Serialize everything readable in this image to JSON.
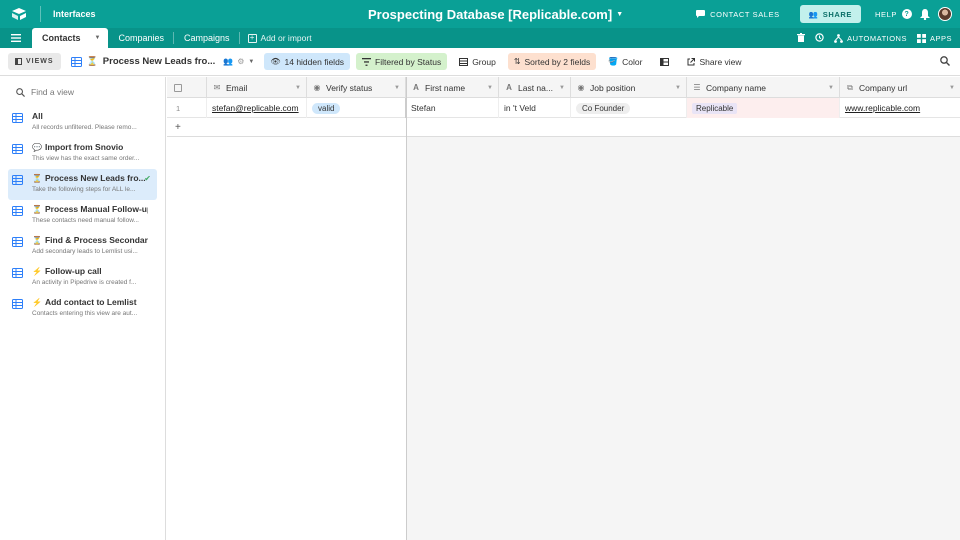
{
  "topbar": {
    "section": "Interfaces",
    "base_title": "Prospecting Database [Replicable.com]",
    "contact_sales": "CONTACT SALES",
    "share": "SHARE",
    "help": "HELP"
  },
  "tabs": {
    "items": [
      {
        "label": "Contacts"
      },
      {
        "label": "Companies"
      },
      {
        "label": "Campaigns"
      }
    ],
    "add_import": "Add or import",
    "automations": "AUTOMATIONS",
    "apps": "APPS"
  },
  "viewbar": {
    "views_label": "VIEWS",
    "current_view": "Process New Leads fro...",
    "hidden_fields": "14 hidden fields",
    "filtered": "Filtered by Status",
    "group": "Group",
    "sorted": "Sorted by 2 fields",
    "color": "Color",
    "share_view": "Share view"
  },
  "sidebar": {
    "find_placeholder": "Find a view",
    "views": [
      {
        "title": "All",
        "desc": "All records unfiltered. Please remo..."
      },
      {
        "title": "Import from Snovio",
        "desc": "This view has the exact same order..."
      },
      {
        "title": "Process New Leads fro...",
        "desc": "Take the following steps for ALL le..."
      },
      {
        "title": "Process Manual Follow-up",
        "desc": "These contacts need manual follow..."
      },
      {
        "title": "Find & Process Secondary ...",
        "desc": "Add secondary leads to Lemlist usi..."
      },
      {
        "title": "Follow-up call",
        "desc": "An activity in Pipedrive is created f..."
      },
      {
        "title": "Add contact to Lemlist",
        "desc": "Contacts entering this view are aut..."
      }
    ]
  },
  "grid": {
    "columns": [
      "Email",
      "Verify status",
      "First name",
      "Last na...",
      "Job position",
      "Company name",
      "Company url"
    ],
    "rows": [
      {
        "num": "1",
        "email": "stefan@replicable.com",
        "verify": "valid",
        "first": "Stefan",
        "last": "in 't Veld",
        "job": "Co Founder",
        "company": "Replicable",
        "url": "www.replicable.com"
      }
    ],
    "add_row": "+"
  },
  "colors": {
    "topbar": "#0aa096",
    "tabsbar": "#089389",
    "hidden_chip": "#cfe7fb",
    "filter_chip": "#d4f1cc",
    "sort_chip": "#fde0cf"
  }
}
